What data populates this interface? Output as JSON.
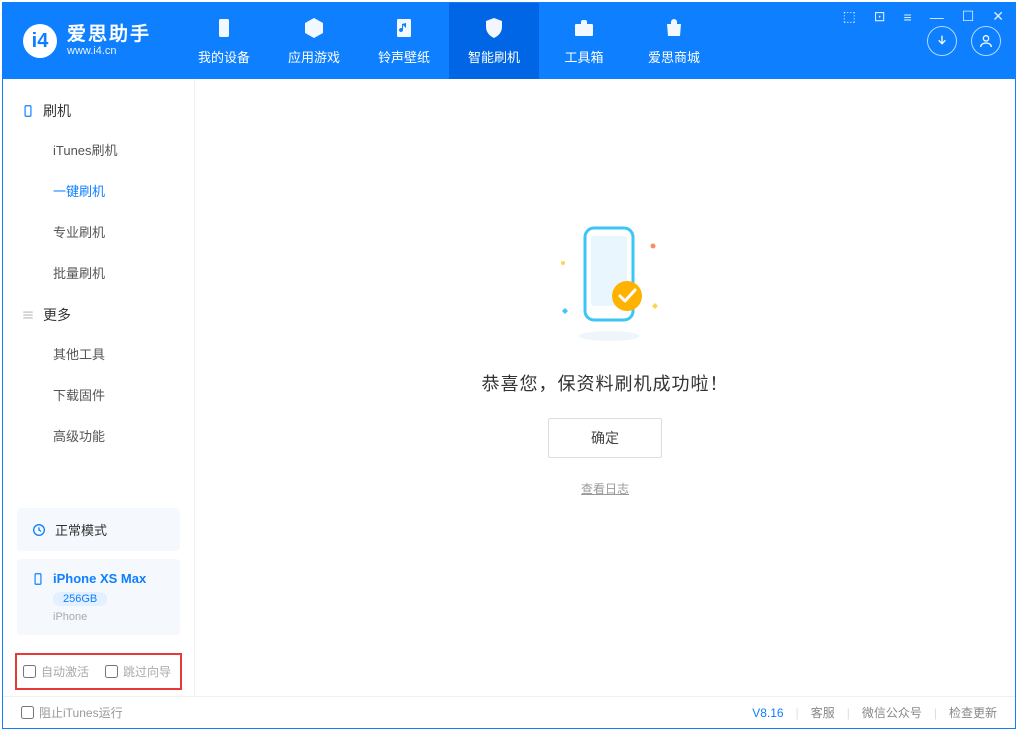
{
  "app": {
    "title": "爱思助手",
    "subtitle": "www.i4.cn"
  },
  "nav": {
    "tabs": [
      {
        "label": "我的设备"
      },
      {
        "label": "应用游戏"
      },
      {
        "label": "铃声壁纸"
      },
      {
        "label": "智能刷机"
      },
      {
        "label": "工具箱"
      },
      {
        "label": "爱思商城"
      }
    ]
  },
  "sidebar": {
    "section1": {
      "title": "刷机"
    },
    "items1": [
      {
        "label": "iTunes刷机"
      },
      {
        "label": "一键刷机"
      },
      {
        "label": "专业刷机"
      },
      {
        "label": "批量刷机"
      }
    ],
    "section2": {
      "title": "更多"
    },
    "items2": [
      {
        "label": "其他工具"
      },
      {
        "label": "下载固件"
      },
      {
        "label": "高级功能"
      }
    ],
    "mode": "正常模式",
    "device": {
      "name": "iPhone XS Max",
      "storage": "256GB",
      "type": "iPhone"
    },
    "checkbox1": "自动激活",
    "checkbox2": "跳过向导"
  },
  "main": {
    "success_message": "恭喜您，保资料刷机成功啦！",
    "confirm": "确定",
    "log_link": "查看日志"
  },
  "statusbar": {
    "block_itunes": "阻止iTunes运行",
    "version": "V8.16",
    "link1": "客服",
    "link2": "微信公众号",
    "link3": "检查更新"
  }
}
